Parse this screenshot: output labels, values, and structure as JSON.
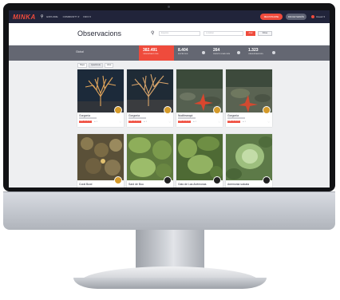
{
  "app": {
    "logo": "MINKA"
  },
  "nav": {
    "items": [
      {
        "label": "EXPLORE"
      },
      {
        "label": "COMMUNITY ▾"
      },
      {
        "label": "INFO ▾"
      }
    ],
    "primary_button": "REGISTRARSE",
    "secondary_button": "INICIAR SESIÓN",
    "user_label": "Usuari ▾"
  },
  "page": {
    "title": "Observacions",
    "species_placeholder": "Espècie",
    "place_placeholder": "Localitat",
    "go_label": "Anar",
    "filters_label": "Filtres"
  },
  "stats": {
    "label": "Global",
    "items": [
      {
        "value": "382.491",
        "label": "OBSERVACIONS",
        "active": true
      },
      {
        "value": "8.404",
        "label": "ESPÈCIES"
      },
      {
        "value": "264",
        "label": "IDENTIFICADORS"
      },
      {
        "value": "1.323",
        "label": "OBSERVADORS"
      }
    ]
  },
  "views": [
    {
      "label": "Mapa"
    },
    {
      "label": "Quadrícula",
      "selected": true
    },
    {
      "label": "Llista"
    }
  ],
  "cards": [
    {
      "name": "Gorgonia",
      "tag": "GRAU DE RECERCA",
      "count": "★ 1"
    },
    {
      "name": "Gorgonia",
      "tag": "GRAU DE RECERCA",
      "count": "★ 1"
    },
    {
      "name": "Nudibranqui",
      "tag": "GRAU DE RECERCA",
      "count": "★ 1"
    },
    {
      "name": "Gorgonia",
      "tag": "GRAU DE RECERCA",
      "count": "★ 1"
    },
    {
      "name": "Coral Bowl"
    },
    {
      "name": "Sard de Bou"
    },
    {
      "name": "Gato de Las Anémonas"
    },
    {
      "name": "Anemonia sulcata"
    }
  ],
  "colors": {
    "accent": "#ef4b3c",
    "topbar": "#21243a",
    "stats": "#646772"
  }
}
